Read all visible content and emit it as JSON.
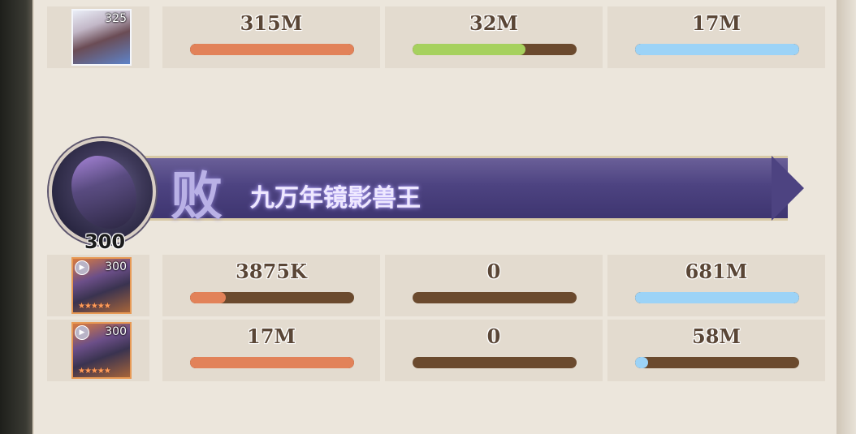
{
  "colors": {
    "damage_bar": "#e28259",
    "heal_bar": "#a6d15e",
    "taken_bar": "#9cd3f7",
    "bar_track": "#6b4a2e",
    "banner": "#4d4381"
  },
  "top_row": {
    "avatar": {
      "icon": "hero-portrait-icon",
      "level": "325"
    },
    "damage": {
      "value": "315M",
      "fill": 1.0
    },
    "heal": {
      "value": "32M",
      "fill": 0.69
    },
    "taken": {
      "value": "17M",
      "fill": 1.0
    }
  },
  "enemy_team": {
    "result": "败",
    "name": "九万年镜影兽王",
    "portrait_level": "300",
    "members": [
      {
        "avatar": {
          "icon": "beast-portrait-icon",
          "level": "300"
        },
        "damage": {
          "value": "3875K",
          "fill": 0.22
        },
        "heal": {
          "value": "0",
          "fill": 0.0
        },
        "taken": {
          "value": "681M",
          "fill": 1.0
        }
      },
      {
        "avatar": {
          "icon": "beast-portrait-icon",
          "level": "300"
        },
        "damage": {
          "value": "17M",
          "fill": 1.0
        },
        "heal": {
          "value": "0",
          "fill": 0.0
        },
        "taken": {
          "value": "58M",
          "fill": 0.08
        }
      }
    ]
  }
}
